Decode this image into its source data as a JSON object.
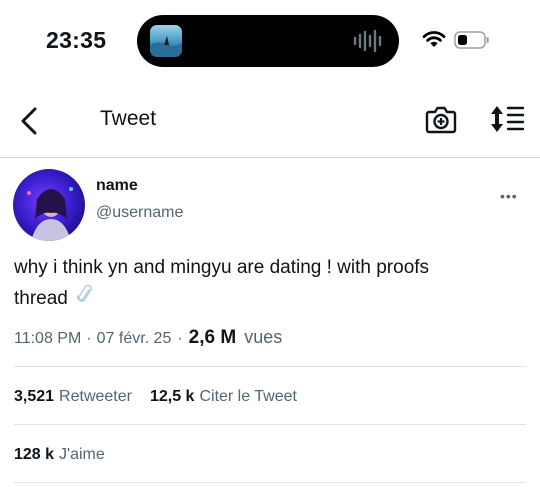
{
  "status_bar": {
    "time": "23:35",
    "icons": [
      "now-playing-artwork-icon",
      "audio-waveform-icon",
      "wifi-icon",
      "battery-icon"
    ]
  },
  "nav": {
    "title": "Tweet",
    "icons": [
      "back-chevron-icon",
      "camera-plus-icon",
      "sort-lines-icon"
    ]
  },
  "tweet": {
    "name": "name",
    "username": "@username",
    "text_line1": "why i think yn and mingyu are dating ! with proofs",
    "text_line2": "thread",
    "link_icon": "paperclip-icon",
    "more_label": "•••",
    "time": "11:08 PM",
    "separator": "·",
    "date": "07 févr. 25",
    "views_count": "2,6 M",
    "views_label": "vues"
  },
  "stats": {
    "retweets_count": "3,521",
    "retweets_label": "Retweeter",
    "quotes_count": "12,5 k",
    "quotes_label": "Citer le Tweet",
    "likes_count": "128 k",
    "likes_label": "J'aime"
  },
  "colors": {
    "text": "#0f1419",
    "secondary": "#536471",
    "divider": "#dfe4e8"
  }
}
